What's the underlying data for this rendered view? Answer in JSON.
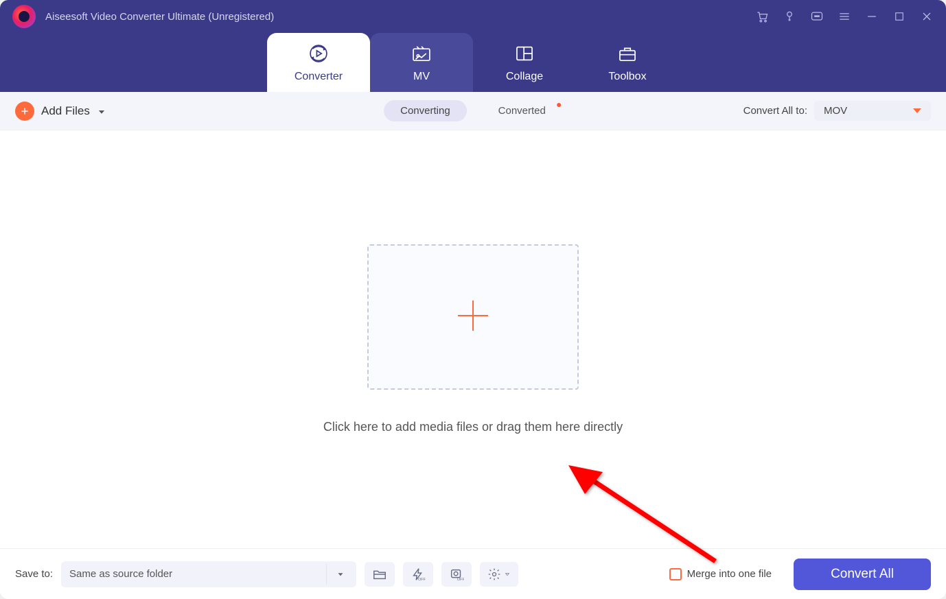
{
  "app": {
    "title": "Aiseesoft Video Converter Ultimate (Unregistered)"
  },
  "header_tabs": {
    "converter": "Converter",
    "mv": "MV",
    "collage": "Collage",
    "toolbox": "Toolbox"
  },
  "toolbar": {
    "add_files": "Add Files",
    "converting": "Converting",
    "converted": "Converted",
    "convert_all_label": "Convert All to:",
    "selected_format": "MOV"
  },
  "main": {
    "drop_text": "Click here to add media files or drag them here directly"
  },
  "footer": {
    "save_to_label": "Save to:",
    "save_folder": "Same as source folder",
    "merge_label": "Merge into one file",
    "convert_button": "Convert All"
  }
}
